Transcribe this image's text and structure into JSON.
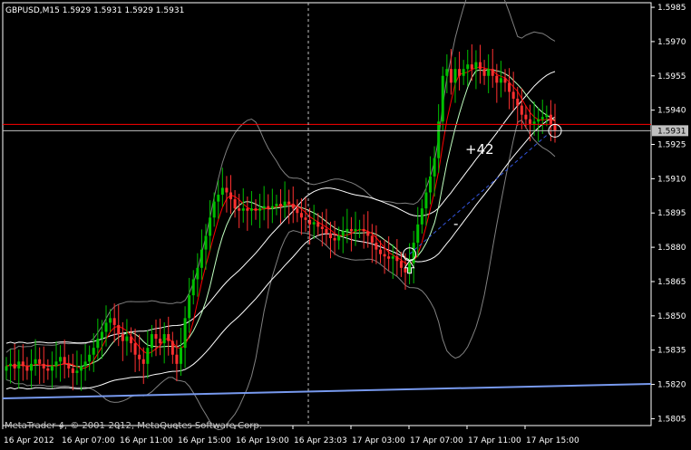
{
  "window": {
    "symbol_info": "GBPUSD,M15  1.5929 1.5931 1.5929 1.5931",
    "copyright": "MetaTrader 4, © 2001-2012, MetaQuotes Software Corp."
  },
  "colors": {
    "background": "#000000",
    "frame": "#ffffff",
    "bull_candle": "#00c000",
    "bear_candle": "#ff3030",
    "fast_ma": "#ff0000",
    "slow_ma": "#c0ffc0",
    "envelope": "#ffffff",
    "bollinger": "#808080",
    "trendline": "#7799ee",
    "horizontal_level": "#ff0000",
    "price_tag": "#c0c0c0"
  },
  "chart_data": {
    "type": "candlestick",
    "symbol": "GBPUSD",
    "timeframe": "M15",
    "ylim": [
      1.5802,
      1.5987
    ],
    "y_ticks": [
      "1.5985",
      "1.5970",
      "1.5955",
      "1.5940",
      "1.5925",
      "1.5910",
      "1.5895",
      "1.5880",
      "1.5865",
      "1.5850",
      "1.5835",
      "1.5820",
      "1.5805"
    ],
    "x_ticks": [
      "16 Apr 2012",
      "16 Apr 07:00",
      "16 Apr 11:00",
      "16 Apr 15:00",
      "16 Apr 19:00",
      "16 Apr 23:03",
      "17 Apr 03:00",
      "17 Apr 07:00",
      "17 Apr 11:00",
      "17 Apr 15:00"
    ],
    "current_price": "1.5931",
    "horizontal_level": 1.5933,
    "crosshair_x": "16 Apr 23:03",
    "crosshair_price": 1.5931,
    "annotations": [
      {
        "text": "+42",
        "type": "profit_label"
      },
      {
        "text": "-",
        "type": "label"
      }
    ],
    "candles_close": [
      1.5828,
      1.5829,
      1.5827,
      1.583,
      1.5828,
      1.5826,
      1.5829,
      1.5831,
      1.5829,
      1.5827,
      1.5826,
      1.5828,
      1.583,
      1.5832,
      1.5829,
      1.5827,
      1.5825,
      1.5826,
      1.5828,
      1.583,
      1.5833,
      1.5836,
      1.584,
      1.5843,
      1.5847,
      1.5849,
      1.5846,
      1.5842,
      1.5839,
      1.5841,
      1.5838,
      1.5833,
      1.5831,
      1.5829,
      1.5836,
      1.5842,
      1.584,
      1.5838,
      1.5842,
      1.5839,
      1.5833,
      1.5829,
      1.5836,
      1.5849,
      1.5859,
      1.5866,
      1.5871,
      1.5879,
      1.5885,
      1.5893,
      1.59,
      1.5903,
      1.5906,
      1.5904,
      1.5901,
      1.5897,
      1.5896,
      1.5897,
      1.5896,
      1.5897,
      1.5896,
      1.5897,
      1.5898,
      1.5897,
      1.5898,
      1.5899,
      1.5898,
      1.59,
      1.5899,
      1.5897,
      1.5895,
      1.5893,
      1.5892,
      1.589,
      1.5891,
      1.5889,
      1.5888,
      1.5886,
      1.5884,
      1.5883,
      1.5885,
      1.5887,
      1.5888,
      1.5887,
      1.5888,
      1.5888,
      1.5887,
      1.5885,
      1.5882,
      1.5879,
      1.5877,
      1.5876,
      1.5875,
      1.5876,
      1.5874,
      1.5871,
      1.5869,
      1.5873,
      1.5882,
      1.589,
      1.5897,
      1.5904,
      1.5911,
      1.5919,
      1.5935,
      1.5955,
      1.5958,
      1.5952,
      1.5958,
      1.5955,
      1.5958,
      1.596,
      1.5958,
      1.5961,
      1.5958,
      1.5955,
      1.5958,
      1.5955,
      1.5952,
      1.5954,
      1.5952,
      1.5948,
      1.5945,
      1.5942,
      1.5938,
      1.5936,
      1.5934,
      1.5935,
      1.5936,
      1.5937,
      1.5938,
      1.5934,
      1.5931
    ]
  }
}
